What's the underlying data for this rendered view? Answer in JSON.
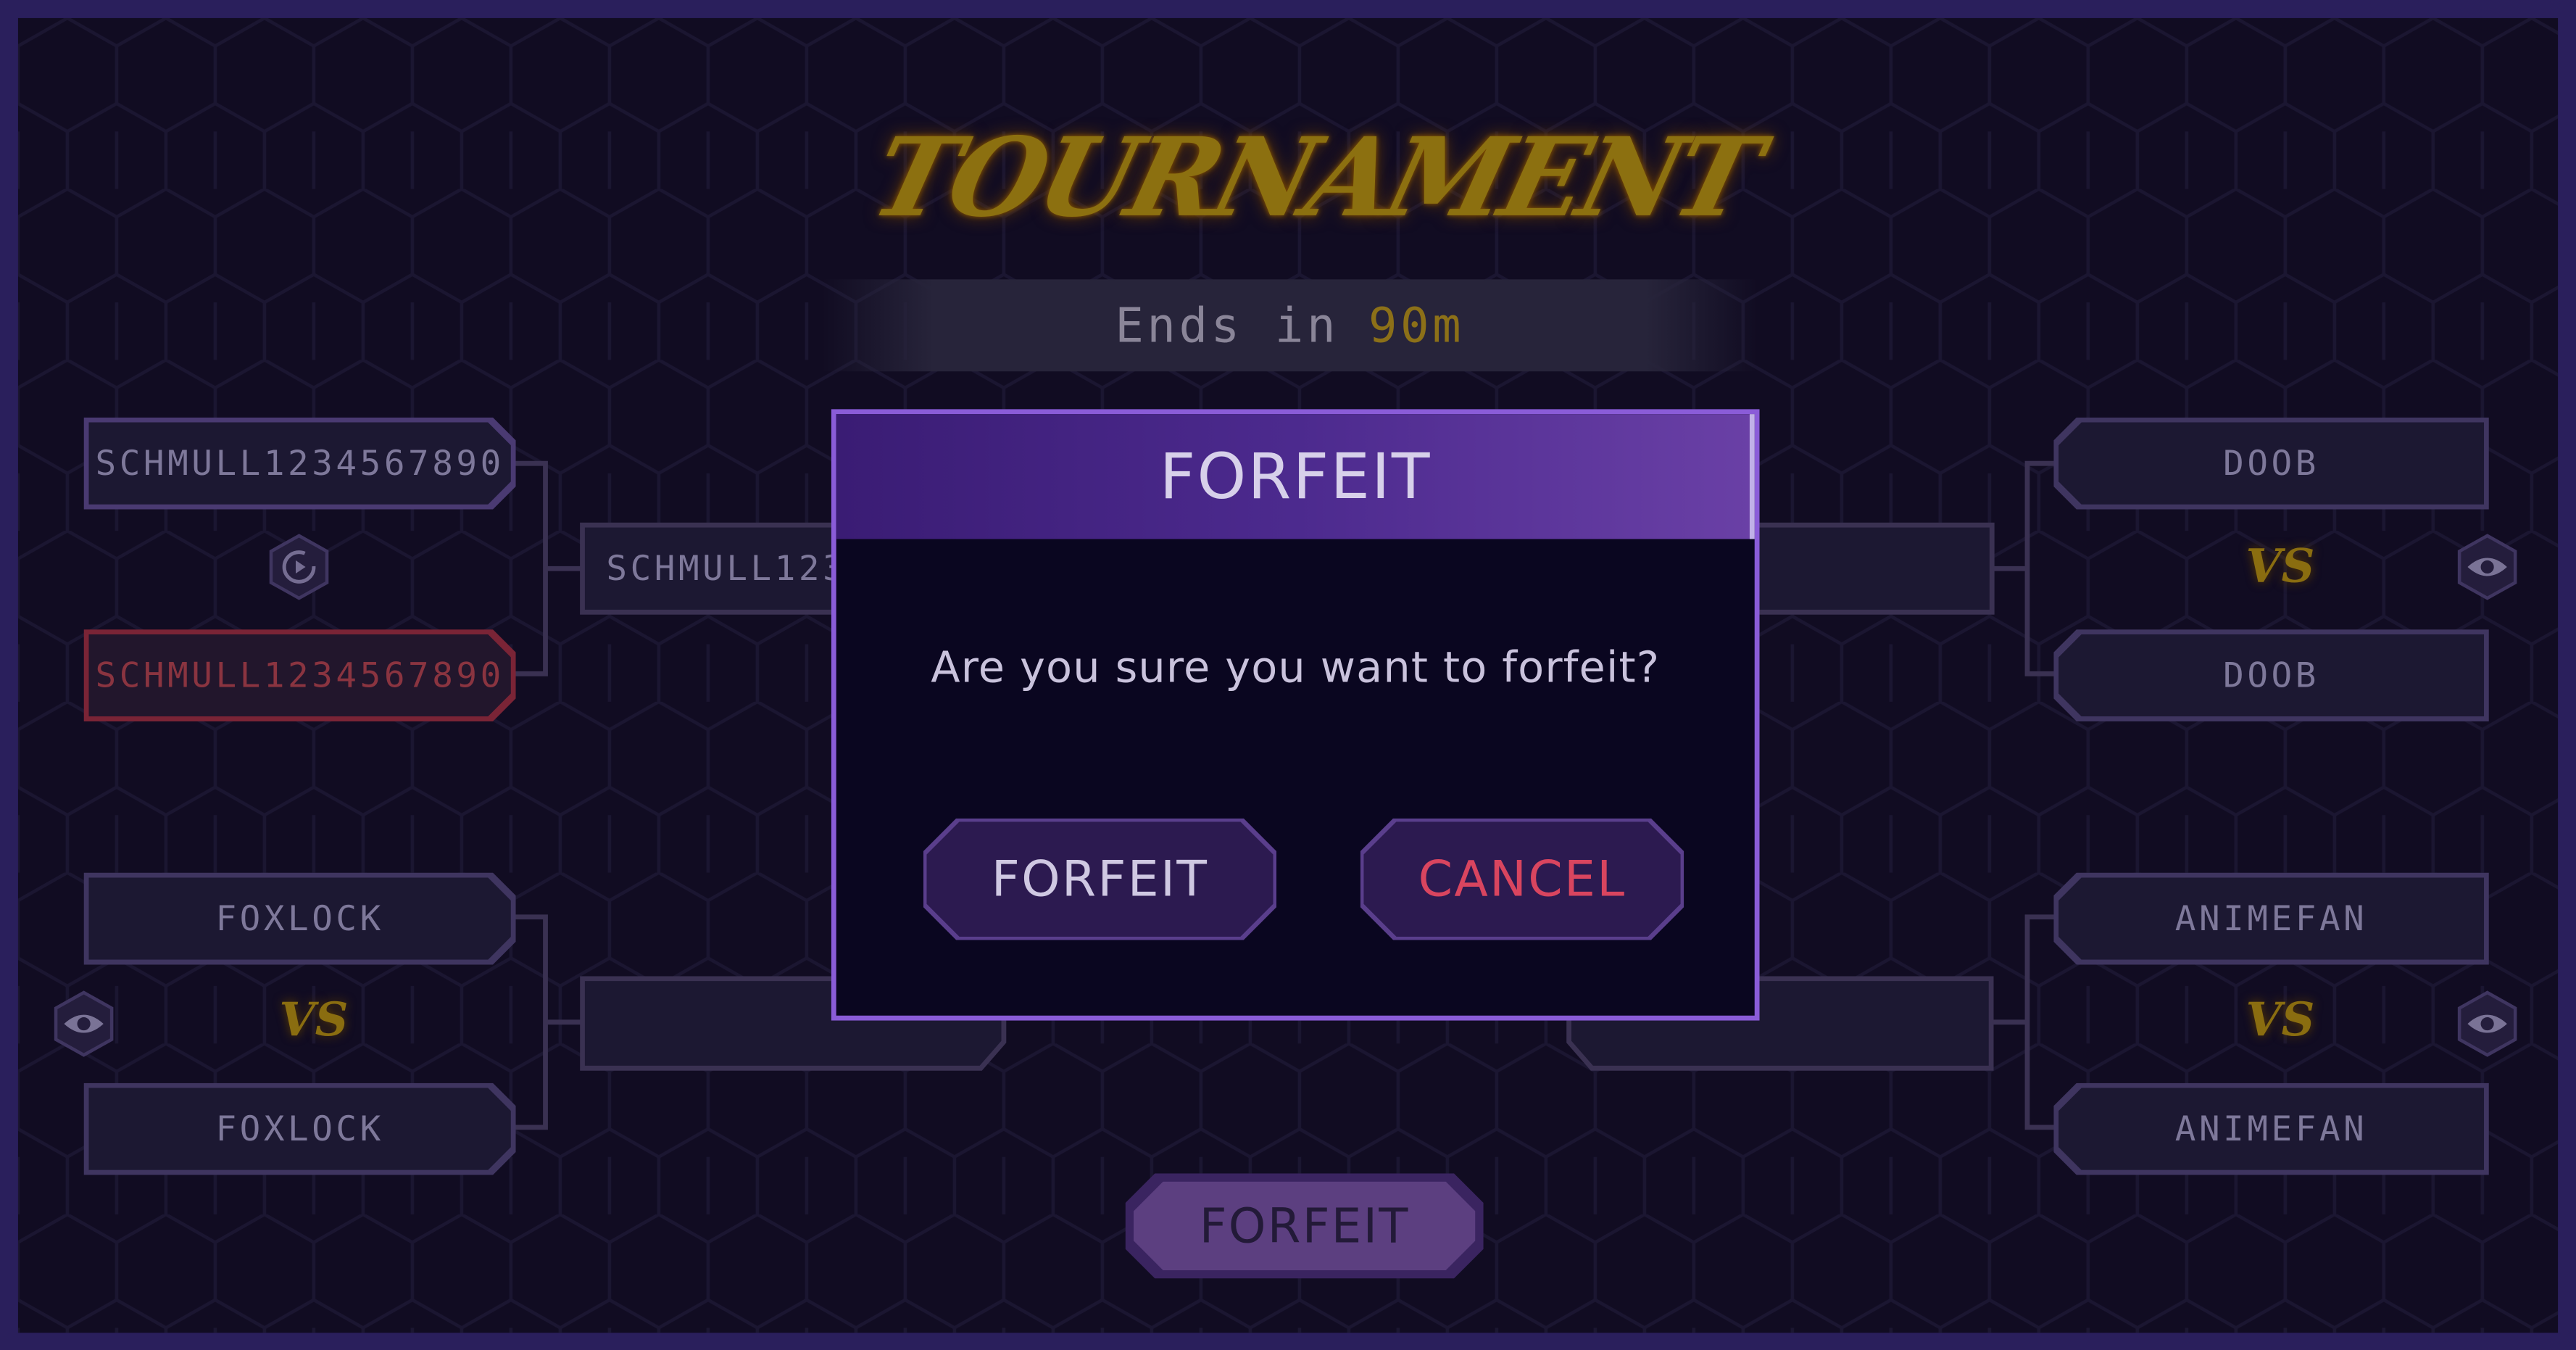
{
  "title": "TOURNAMENT",
  "timer": {
    "prefix": "Ends in",
    "value": "90m"
  },
  "bracket": {
    "left": {
      "match1": {
        "player_top": "SCHMULL1234567890",
        "player_bottom": "SCHMULL1234567890",
        "control": "replay-icon"
      },
      "match2": {
        "player_top": "FOXLOCK",
        "player_bottom": "FOXLOCK",
        "vs_label": "VS",
        "control": "eye-icon"
      },
      "round2_top": "SCHMULL123",
      "round2_bottom": ""
    },
    "right": {
      "match1": {
        "player_top": "DOOB",
        "player_bottom": "DOOB",
        "vs_label": "VS",
        "control": "eye-icon"
      },
      "match2": {
        "player_top": "ANIMEFAN",
        "player_bottom": "ANIMEFAN",
        "vs_label": "VS",
        "control": "eye-icon"
      },
      "round2_top": "",
      "round2_bottom": ""
    }
  },
  "bottom_button": "FORFEIT",
  "modal": {
    "title": "FORFEIT",
    "question": "Are you sure you want to forfeit?",
    "confirm_label": "FORFEIT",
    "cancel_label": "CANCEL"
  },
  "colors": {
    "accent_purple": "#8a5cd8",
    "gold": "#8c7010",
    "danger": "#d9455f",
    "background": "#110c22"
  }
}
